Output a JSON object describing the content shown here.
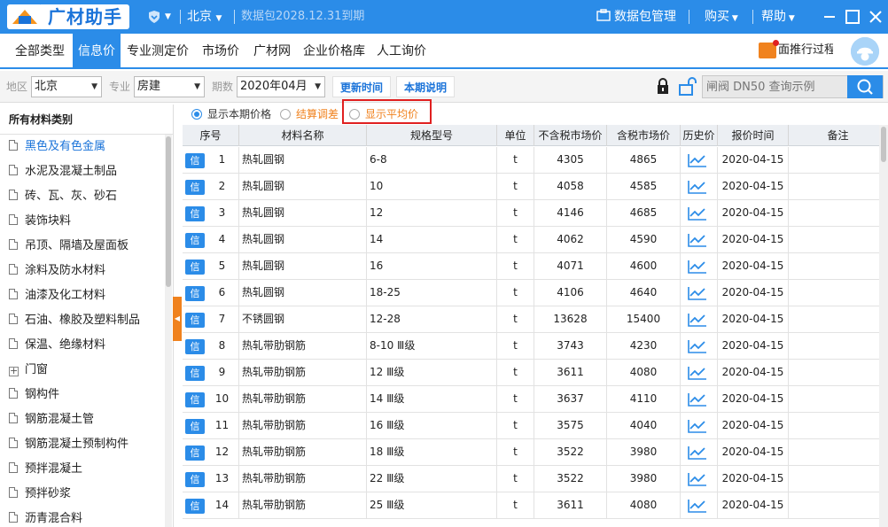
{
  "titlebar": {
    "logo_text": "广材助手",
    "city": "北京",
    "expire": "数据包2028.12.31到期",
    "data_pkg": "数据包管理",
    "buy": "购买",
    "help": "帮助"
  },
  "menu": {
    "items": [
      "全部类型",
      "信息价",
      "专业测定价",
      "市场价",
      "广材网",
      "企业价格库",
      "人工询价"
    ],
    "active": "信息价",
    "promo": "面推行过程"
  },
  "filters": {
    "region_label": "地区",
    "region_value": "北京",
    "specialty_label": "专业",
    "specialty_value": "房建",
    "period_label": "期数",
    "period_value": "2020年04月",
    "update_time_btn": "更新时间",
    "period_note_btn": "本期说明",
    "search_placeholder": "闸阀 DN50 查询示例"
  },
  "sidebar": {
    "header": "所有材料类别",
    "items": [
      {
        "label": "黑色及有色金属",
        "active": true,
        "expandable": false
      },
      {
        "label": "水泥及混凝土制品",
        "active": false,
        "expandable": false
      },
      {
        "label": "砖、瓦、灰、砂石",
        "active": false,
        "expandable": false
      },
      {
        "label": "装饰块料",
        "active": false,
        "expandable": false
      },
      {
        "label": "吊顶、隔墙及屋面板",
        "active": false,
        "expandable": false
      },
      {
        "label": "涂料及防水材料",
        "active": false,
        "expandable": false
      },
      {
        "label": "油漆及化工材料",
        "active": false,
        "expandable": false
      },
      {
        "label": "石油、橡胶及塑料制品",
        "active": false,
        "expandable": false
      },
      {
        "label": "保温、绝缘材料",
        "active": false,
        "expandable": false
      },
      {
        "label": "门窗",
        "active": false,
        "expandable": true
      },
      {
        "label": "钢构件",
        "active": false,
        "expandable": false
      },
      {
        "label": "钢筋混凝土管",
        "active": false,
        "expandable": false
      },
      {
        "label": "钢筋混凝土预制构件",
        "active": false,
        "expandable": false
      },
      {
        "label": "预拌混凝土",
        "active": false,
        "expandable": false
      },
      {
        "label": "预拌砂浆",
        "active": false,
        "expandable": false
      },
      {
        "label": "沥青混合料",
        "active": false,
        "expandable": false
      }
    ]
  },
  "radios": {
    "current": "显示本期价格",
    "settle": "结算调差",
    "average": "显示平均价"
  },
  "table": {
    "headers": [
      "序号",
      "材料名称",
      "规格型号",
      "单位",
      "不含税市场价",
      "含税市场价",
      "历史价",
      "报价时间",
      "备注"
    ],
    "badge": "信",
    "rows": [
      {
        "no": "1",
        "name": "热轧圆钢",
        "spec": "6-8",
        "unit": "t",
        "price_ex": "4305",
        "price_in": "4865",
        "date": "2020-04-15",
        "note": ""
      },
      {
        "no": "2",
        "name": "热轧圆钢",
        "spec": "10",
        "unit": "t",
        "price_ex": "4058",
        "price_in": "4585",
        "date": "2020-04-15",
        "note": ""
      },
      {
        "no": "3",
        "name": "热轧圆钢",
        "spec": "12",
        "unit": "t",
        "price_ex": "4146",
        "price_in": "4685",
        "date": "2020-04-15",
        "note": ""
      },
      {
        "no": "4",
        "name": "热轧圆钢",
        "spec": "14",
        "unit": "t",
        "price_ex": "4062",
        "price_in": "4590",
        "date": "2020-04-15",
        "note": ""
      },
      {
        "no": "5",
        "name": "热轧圆钢",
        "spec": "16",
        "unit": "t",
        "price_ex": "4071",
        "price_in": "4600",
        "date": "2020-04-15",
        "note": ""
      },
      {
        "no": "6",
        "name": "热轧圆钢",
        "spec": "18-25",
        "unit": "t",
        "price_ex": "4106",
        "price_in": "4640",
        "date": "2020-04-15",
        "note": ""
      },
      {
        "no": "7",
        "name": "不锈圆钢",
        "spec": "12-28",
        "unit": "t",
        "price_ex": "13628",
        "price_in": "15400",
        "date": "2020-04-15",
        "note": ""
      },
      {
        "no": "8",
        "name": "热轧带肋钢筋",
        "spec": "8-10 Ⅲ级",
        "unit": "t",
        "price_ex": "3743",
        "price_in": "4230",
        "date": "2020-04-15",
        "note": ""
      },
      {
        "no": "9",
        "name": "热轧带肋钢筋",
        "spec": "12 Ⅲ级",
        "unit": "t",
        "price_ex": "3611",
        "price_in": "4080",
        "date": "2020-04-15",
        "note": ""
      },
      {
        "no": "10",
        "name": "热轧带肋钢筋",
        "spec": "14 Ⅲ级",
        "unit": "t",
        "price_ex": "3637",
        "price_in": "4110",
        "date": "2020-04-15",
        "note": ""
      },
      {
        "no": "11",
        "name": "热轧带肋钢筋",
        "spec": "16 Ⅲ级",
        "unit": "t",
        "price_ex": "3575",
        "price_in": "4040",
        "date": "2020-04-15",
        "note": ""
      },
      {
        "no": "12",
        "name": "热轧带肋钢筋",
        "spec": "18 Ⅲ级",
        "unit": "t",
        "price_ex": "3522",
        "price_in": "3980",
        "date": "2020-04-15",
        "note": ""
      },
      {
        "no": "13",
        "name": "热轧带肋钢筋",
        "spec": "22 Ⅲ级",
        "unit": "t",
        "price_ex": "3522",
        "price_in": "3980",
        "date": "2020-04-15",
        "note": ""
      },
      {
        "no": "14",
        "name": "热轧带肋钢筋",
        "spec": "25 Ⅲ级",
        "unit": "t",
        "price_ex": "3611",
        "price_in": "4080",
        "date": "2020-04-15",
        "note": ""
      }
    ]
  },
  "colors": {
    "primary": "#2b8ce8",
    "accent_orange": "#f0821e",
    "highlight_red": "#e02020"
  }
}
